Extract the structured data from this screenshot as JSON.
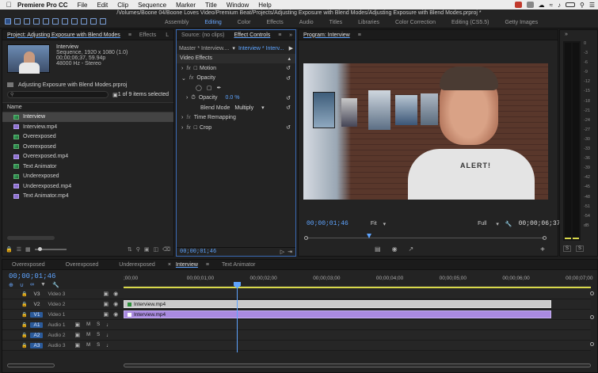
{
  "menubar": {
    "app_name": "Premiere Pro CC",
    "items": [
      "File",
      "Edit",
      "Clip",
      "Sequence",
      "Marker",
      "Title",
      "Window",
      "Help"
    ]
  },
  "path": "/Volumes/Boone 04/Boone Loves Video/Premium Beat/Projects/Adjusting Exposure with Blend Modes/Adjusting Exposure with Blend Modes.prproj *",
  "workspaces": [
    "Assembly",
    "Editing",
    "Color",
    "Effects",
    "Audio",
    "Titles",
    "Libraries",
    "Color Correction",
    "Editing (CS5.5)",
    "Getty Images"
  ],
  "workspace_active": "Editing",
  "project": {
    "tab_label": "Project: Adjusting Exposure with Blend Modes",
    "effects_tab": "Effects",
    "overflow_tab": "L",
    "clip_name": "Interview",
    "clip_info1": "Sequence, 1920 x 1080 (1.0)",
    "clip_info2": "00;00;06;37, 59.94p",
    "clip_info3": "48000 Hz - Stereo",
    "filename": "Adjusting Exposure with Blend Modes.prproj",
    "search_placeholder": "",
    "items_count": "1 of 9 items selected",
    "name_header": "Name",
    "items": [
      {
        "name": "Interview",
        "type": "seq",
        "selected": true
      },
      {
        "name": "Interview.mp4",
        "type": "vid"
      },
      {
        "name": "Overexposed",
        "type": "seq"
      },
      {
        "name": "Overexposed",
        "type": "seq"
      },
      {
        "name": "Overexposed.mp4",
        "type": "vid"
      },
      {
        "name": "Text Animator",
        "type": "seq"
      },
      {
        "name": "Underexposed",
        "type": "seq"
      },
      {
        "name": "Underexposed.mp4",
        "type": "vid"
      },
      {
        "name": "Text Animator.mp4",
        "type": "vid"
      }
    ]
  },
  "effect_controls": {
    "source_tab": "Source: (no clips)",
    "tab_label": "Effect Controls",
    "master": "Master * Interview....",
    "clip_dropdown": "Interview * Interv...",
    "section": "Video Effects",
    "motion": "Motion",
    "opacity": "Opacity",
    "opacity_prop": "Opacity",
    "opacity_value": "0.0 %",
    "blend_label": "Blend Mode",
    "blend_value": "Multiply",
    "time_remap": "Time Remapping",
    "crop": "Crop",
    "timecode": "00;00;01;46"
  },
  "program": {
    "tab_label": "Program: Interview",
    "timecode": "00;00;01;46",
    "fit": "Fit",
    "full": "Full",
    "duration": "00;00;06;37",
    "shirt_text": "ALERT!"
  },
  "meter": {
    "scale": [
      "0",
      "-6",
      "-12",
      "-18",
      "-24",
      "-30",
      "-36",
      "-42",
      "-48",
      "-54",
      "dB"
    ],
    "scale_full": [
      "0",
      "-3",
      "-6",
      "-9",
      "-12",
      "-15",
      "-18",
      "-21",
      "-24",
      "-27",
      "-30",
      "-33",
      "-36",
      "-39",
      "-42",
      "-45",
      "-48",
      "-51",
      "-54",
      "dB"
    ],
    "solo_labels": [
      "S",
      "S"
    ]
  },
  "timeline": {
    "tabs": [
      "Overexposed",
      "Overexposed",
      "Underexposed",
      "Interview",
      "Text Animator"
    ],
    "active_tab": "Interview",
    "timecode": "00;00;01;46",
    "ruler": [
      ";00;00",
      "00;00;01;00",
      "00;00;02;00",
      "00;00;03;00",
      "00;00;04;00",
      "00;00;05;00",
      "00;00;06;00",
      "00;00;07;00"
    ],
    "video_tracks": [
      {
        "id": "V3",
        "name": "Video 3",
        "clip": ""
      },
      {
        "id": "V2",
        "name": "Video 2",
        "clip": "Interview.mp4"
      },
      {
        "id": "V1",
        "name": "Video 1",
        "clip": "Interview.mp4"
      }
    ],
    "audio_tracks": [
      {
        "id": "A1",
        "name": "Audio 1"
      },
      {
        "id": "A2",
        "name": "Audio 2"
      },
      {
        "id": "A3",
        "name": "Audio 3"
      }
    ]
  }
}
